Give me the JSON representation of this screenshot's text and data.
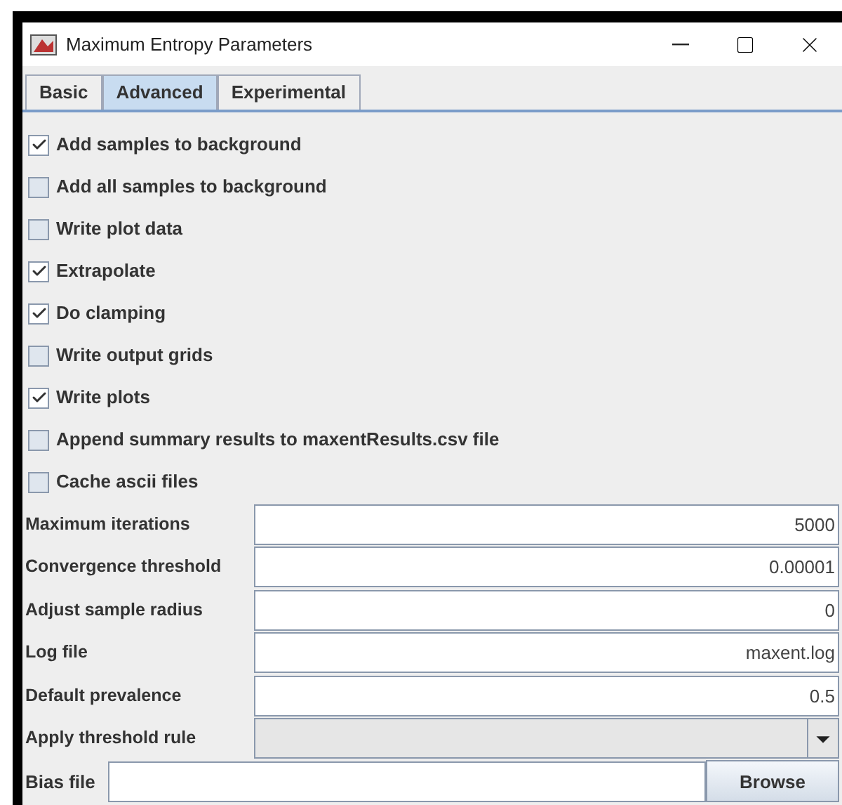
{
  "window": {
    "title": "Maximum Entropy Parameters"
  },
  "tabs": [
    {
      "label": "Basic",
      "selected": false
    },
    {
      "label": "Advanced",
      "selected": true
    },
    {
      "label": "Experimental",
      "selected": false
    }
  ],
  "options": [
    {
      "label": "Add samples to background",
      "checked": true
    },
    {
      "label": "Add all samples to background",
      "checked": false
    },
    {
      "label": "Write plot data",
      "checked": false
    },
    {
      "label": "Extrapolate",
      "checked": true
    },
    {
      "label": "Do clamping",
      "checked": true
    },
    {
      "label": "Write output grids",
      "checked": false
    },
    {
      "label": "Write plots",
      "checked": true
    },
    {
      "label": "Append summary results to maxentResults.csv file",
      "checked": false
    },
    {
      "label": "Cache ascii files",
      "checked": false
    }
  ],
  "fields": [
    {
      "kind": "text",
      "label": "Maximum iterations",
      "value": "5000"
    },
    {
      "kind": "text",
      "label": "Convergence threshold",
      "value": "0.00001"
    },
    {
      "kind": "text",
      "label": "Adjust sample radius",
      "value": "0"
    },
    {
      "kind": "text",
      "label": "Log file",
      "value": "maxent.log"
    },
    {
      "kind": "text",
      "label": "Default prevalence",
      "value": "0.5"
    },
    {
      "kind": "dropdown",
      "label": "Apply threshold rule"
    }
  ],
  "bias_file": {
    "label": "Bias file",
    "button": "Browse"
  }
}
